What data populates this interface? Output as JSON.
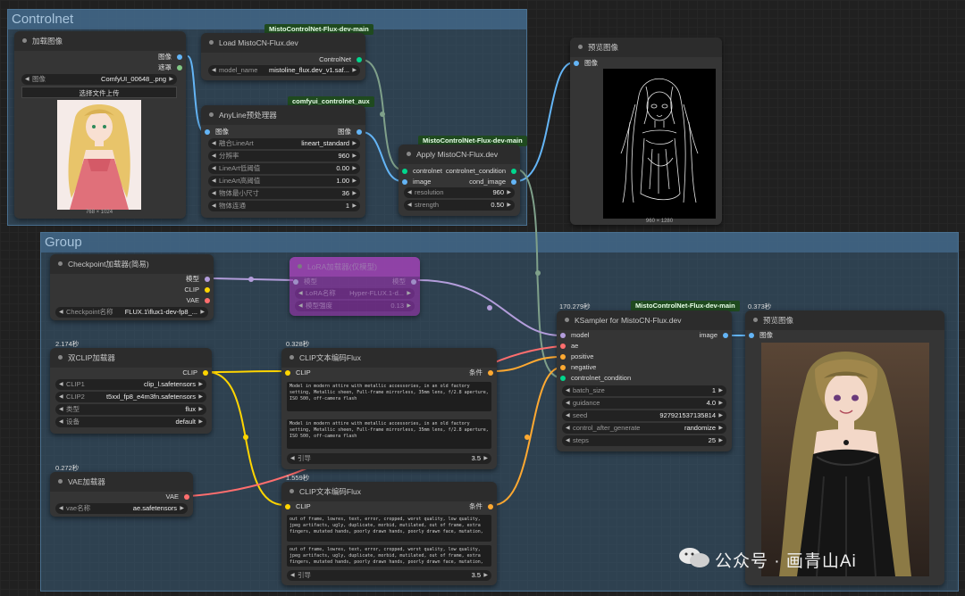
{
  "groups": {
    "controlnet": "Controlnet",
    "group": "Group"
  },
  "badges": {
    "misto_main": "MistoControlNet-Flux-dev-main",
    "aux": "comfyui_controlnet_aux"
  },
  "nodes": {
    "load_image": {
      "title": "加载图像",
      "out_image": "图像",
      "out_mask": "遮罩",
      "image_label": "图像",
      "image_value": "ComfyUI_00648_.png",
      "upload_button": "选择文件上传",
      "caption": "768 × 1024"
    },
    "load_misto": {
      "title": "Load MistoCN-Flux.dev",
      "out_controlnet": "ControlNet",
      "model_label": "model_name",
      "model_value": "mistoline_flux.dev_v1.saf..."
    },
    "anyline": {
      "title": "AnyLine预处理器",
      "in_image": "图像",
      "out_image": "图像",
      "widgets": [
        {
          "label": "融合LineArt",
          "value": "lineart_standard"
        },
        {
          "label": "分辨率",
          "value": "960"
        },
        {
          "label": "LineArt低阈值",
          "value": "0.00"
        },
        {
          "label": "LineArt高阈值",
          "value": "1.00"
        },
        {
          "label": "物体最小尺寸",
          "value": "36"
        },
        {
          "label": "物体连通",
          "value": "1"
        }
      ]
    },
    "apply_misto": {
      "title": "Apply MistoCN-Flux.dev",
      "in_controlnet": "controlnet",
      "in_image": "image",
      "out_condition": "controlnet_condition",
      "out_cond_image": "cond_image",
      "widgets": [
        {
          "label": "resolution",
          "value": "960"
        },
        {
          "label": "strength",
          "value": "0.50"
        }
      ]
    },
    "preview1": {
      "title": "预览图像",
      "in_image": "图像",
      "caption": "960 × 1280"
    },
    "checkpoint": {
      "title": "Checkpoint加载器(简易)",
      "out_model": "模型",
      "out_clip": "CLIP",
      "out_vae": "VAE",
      "ckpt_label": "Checkpoint名称",
      "ckpt_value": "FLUX.1\\flux1-dev-fp8_..."
    },
    "lora": {
      "title": "LoRA加载器(仅模型)",
      "in_model": "模型",
      "out_model": "模型",
      "lora_label": "LoRA名称",
      "lora_value": "Hyper-FLUX.1-d...",
      "strength_label": "模型强度",
      "strength_value": "0.13"
    },
    "dual_clip": {
      "time": "2.174秒",
      "title": "双CLIP加载器",
      "out_clip": "CLIP",
      "widgets": [
        {
          "label": "CLIP1",
          "value": "clip_l.safetensors"
        },
        {
          "label": "CLIP2",
          "value": "t5xxl_fp8_e4m3fn.safetensors"
        },
        {
          "label": "类型",
          "value": "flux"
        },
        {
          "label": "设备",
          "value": "default"
        }
      ]
    },
    "vae": {
      "time": "0.272秒",
      "title": "VAE加载器",
      "out_vae": "VAE",
      "vae_label": "vae名称",
      "vae_value": "ae.safetensors"
    },
    "clip_pos": {
      "time": "0.328秒",
      "title": "CLIP文本编码Flux",
      "in_clip": "CLIP",
      "out_cond": "条件",
      "text1": "Model in modern attire with metallic accessories, in an old factory setting, Metallic sheen, Full-frame mirrorless, 35mm lens, f/2.8 aperture, ISO 500, off-camera flash",
      "text2": "Model in modern attire with metallic accessories, in an old factory setting, Metallic sheen, Full-frame mirrorless, 35mm lens, f/2.8 aperture, ISO 500, off-camera flash",
      "guidance_label": "引导",
      "guidance_value": "3.5"
    },
    "clip_neg": {
      "time": "1.559秒",
      "title": "CLIP文本编码Flux",
      "in_clip": "CLIP",
      "out_cond": "条件",
      "text1": "out of frame, lowres, text, error, cropped, worst quality, low quality, jpeg artifacts, ugly, duplicate, morbid, mutilated, out of frame, extra fingers, mutated hands, poorly drawn hands, poorly drawn face, mutation,",
      "text2": "out of frame, lowres, text, error, cropped, worst quality, low quality, jpeg artifacts, ugly, duplicate, morbid, mutilated, out of frame, extra fingers, mutated hands, poorly drawn hands, poorly drawn face, mutation,",
      "guidance_label": "引导",
      "guidance_value": "3.5"
    },
    "ksampler": {
      "time": "170.279秒",
      "title": "KSampler for MistoCN-Flux.dev",
      "in_model": "model",
      "in_ae": "ae",
      "in_positive": "positive",
      "in_negative": "negative",
      "in_controlnet": "controlnet_condition",
      "out_image": "image",
      "widgets": [
        {
          "label": "batch_size",
          "value": "1"
        },
        {
          "label": "guidance",
          "value": "4.0"
        },
        {
          "label": "seed",
          "value": "927921537135814"
        },
        {
          "label": "control_after_generate",
          "value": "randomize"
        },
        {
          "label": "steps",
          "value": "25"
        }
      ]
    },
    "preview2": {
      "time": "0.373秒",
      "title": "预览图像",
      "in_image": "图像"
    }
  },
  "watermark": "公众号 · 画青山Ai",
  "colors": {
    "image_port": "#64b5f6",
    "mask_port": "#81c784",
    "model_port": "#b39ddb",
    "clip_port": "#ffd500",
    "vae_port": "#ff6e6e",
    "cond_port": "#ffa931",
    "controlnet_port": "#00d78d",
    "group_controlnet": "#3a5c78"
  }
}
